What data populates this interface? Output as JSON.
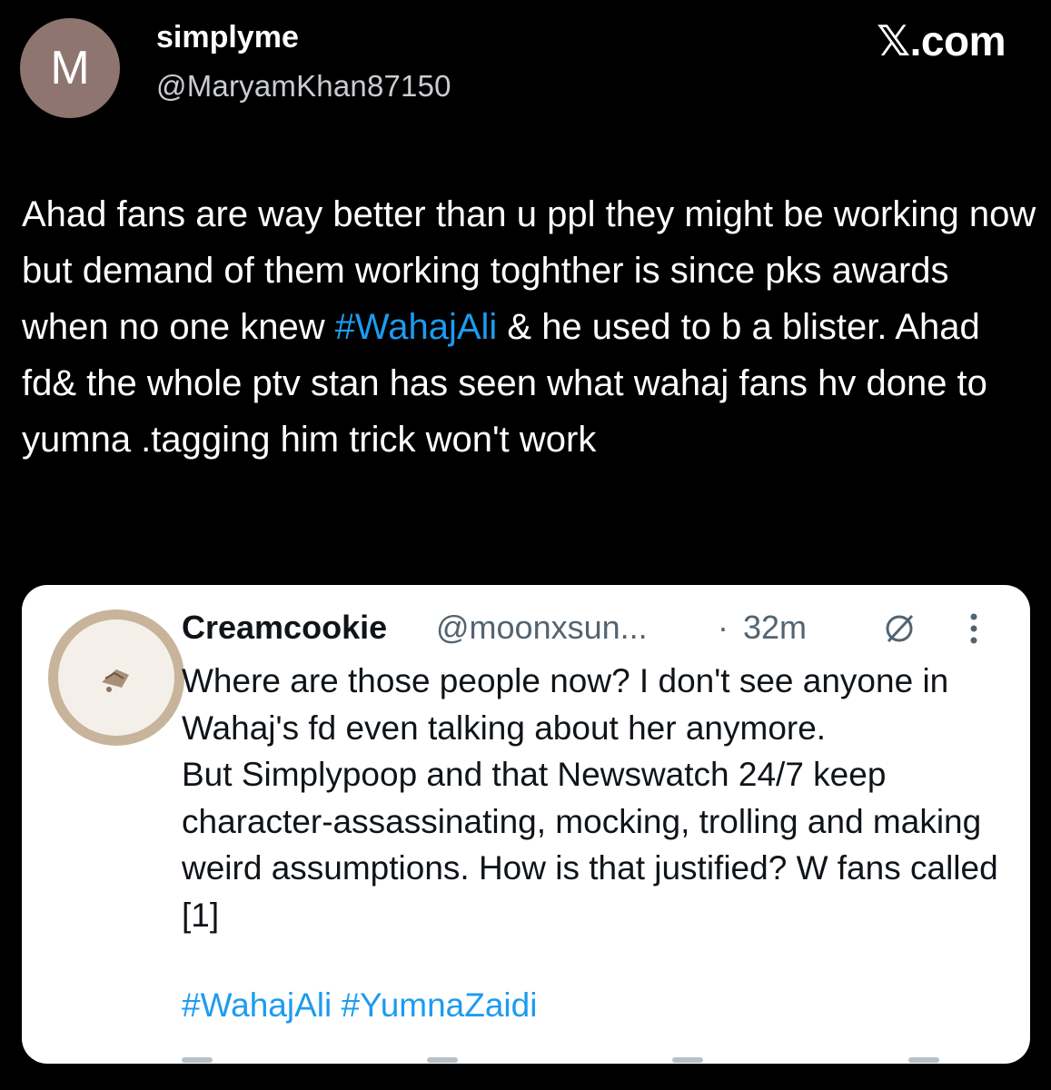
{
  "post": {
    "avatar_initial": "M",
    "display_name": "simplyme",
    "handle": "@MaryamKhan87150",
    "brand": "𝕏.com",
    "text": {
      "part1": "Ahad fans are way better than u ppl they might be working now but  demand of them working toghther is since pks awards when no one knew ",
      "hashtag": "#WahajAli",
      "part2": " & he used to b a blister. Ahad fd& the whole ptv stan has seen what wahaj fans hv done to yumna .tagging him trick won't work"
    }
  },
  "quote": {
    "display_name": "Creamcookie",
    "handle": "@moonxsun...",
    "separator": "·",
    "time": "32m",
    "body": "Where are those people now? I don't see anyone in Wahaj's fd even talking about her anymore.\nBut Simplypoop and that Newswatch 24/7 keep character-assassinating, mocking, trolling and making weird assumptions. How is that justified? W fans called [1]",
    "hashtags": "#WahajAli #YumnaZaidi",
    "icons": [
      "grok-icon",
      "more-options-icon"
    ]
  },
  "colors": {
    "background": "#000000",
    "text": "#ffffff",
    "handle": "#c9ccd0",
    "link": "#1d9bf0",
    "avatar": "#8e7570",
    "card": "#ffffff",
    "muted": "#536471"
  }
}
